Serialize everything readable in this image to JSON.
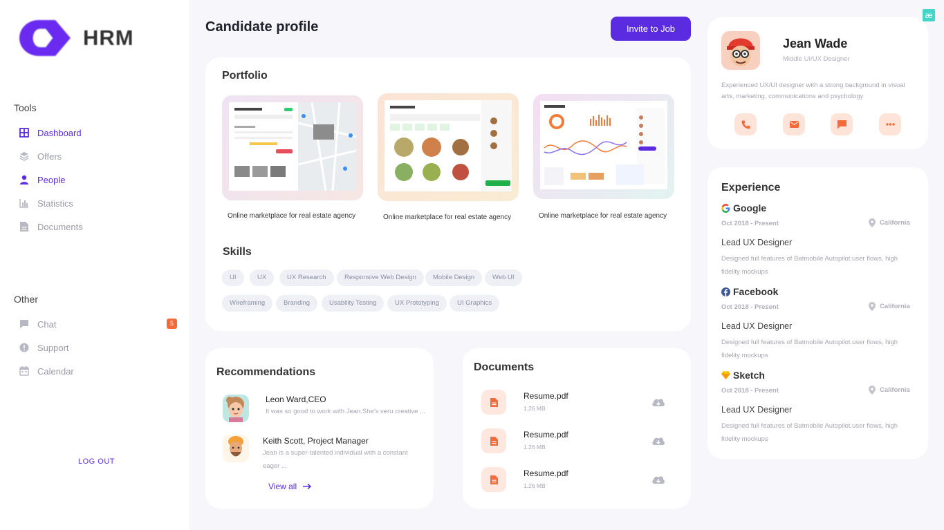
{
  "app": {
    "brand": "HRM"
  },
  "sidebar": {
    "tools_title": "Tools",
    "tools": [
      {
        "label": "Dashboard",
        "icon": "grid-icon",
        "active": true
      },
      {
        "label": "Offers",
        "icon": "layers-icon"
      },
      {
        "label": "People",
        "icon": "person-icon",
        "active": true
      },
      {
        "label": "Statistics",
        "icon": "bar-chart-icon"
      },
      {
        "label": "Documents",
        "icon": "document-icon"
      }
    ],
    "other_title": "Other",
    "other": [
      {
        "label": "Chat",
        "icon": "chat-icon",
        "badge": "5"
      },
      {
        "label": "Support",
        "icon": "alert-circle-icon"
      },
      {
        "label": "Calendar",
        "icon": "calendar-icon"
      }
    ],
    "logout": "LOG OUT"
  },
  "header": {
    "title": "Candidate profile",
    "invite_label": "Invite to Job",
    "corner_icon": "æ"
  },
  "portfolio": {
    "title": "Portfolio",
    "items": [
      {
        "caption": "Online marketplace for real estate agency"
      },
      {
        "caption": "Online marketplace for real estate agency"
      },
      {
        "caption": "Online marketplace for real estate agency"
      }
    ]
  },
  "skills": {
    "title": "Skills",
    "row1": [
      "UI",
      "UX",
      "UX Research",
      "Responsive Web Design",
      "Mobile Design",
      "Web UI"
    ],
    "row2": [
      "Wireframing",
      "Branding",
      "Usability Testing",
      "UX Prototyping",
      "UI Graphics"
    ]
  },
  "recommendations": {
    "title": "Recommendations",
    "items": [
      {
        "name": "Leon Ward,CEO",
        "text": "It was so good to work with Jean.She's veru creative ..."
      },
      {
        "name": "Keith Scott, Project Manager",
        "text": "Jean is a super-talented individual with a constant eager ..."
      }
    ],
    "view_all": "View all"
  },
  "documents": {
    "title": "Documents",
    "items": [
      {
        "name": "Resume.pdf",
        "size": "1.26 MB"
      },
      {
        "name": "Resume.pdf",
        "size": "1.26 MB"
      },
      {
        "name": "Resume.pdf",
        "size": "1.26 MB"
      }
    ]
  },
  "profile": {
    "name": "Jean Wade",
    "role": "Middle UI/UX Designer",
    "bio": "Experienced UX/UI designer with a strong background in visual arts, marketing, communications and psychology",
    "actions": [
      "phone-icon",
      "mail-icon",
      "message-icon",
      "more-icon"
    ]
  },
  "experience": {
    "title": "Experience",
    "items": [
      {
        "company": "Google",
        "period": "Oct 2018 - Present",
        "location": "California",
        "title": "Lead UX Designer",
        "desc": "Designed full features of Batmobile Autopilot.user flows, high fidelity mockups"
      },
      {
        "company": "Facebook",
        "period": "Oct 2018 - Present",
        "location": "California",
        "title": "Lead UX Designer",
        "desc": "Designed full features of Batmobile Autopilot.user flows, high fidelity mockups"
      },
      {
        "company": "Sketch",
        "period": "Oct 2018 - Present",
        "location": "California",
        "title": "Lead UX Designer",
        "desc": "Designed full features of Batmobile Autopilot.user flows, high fidelity mockups"
      }
    ]
  },
  "colors": {
    "accent": "#5b2be0",
    "badge": "#f26b3a",
    "soft_orange": "#fde3d8",
    "orange": "#f26b3a"
  }
}
